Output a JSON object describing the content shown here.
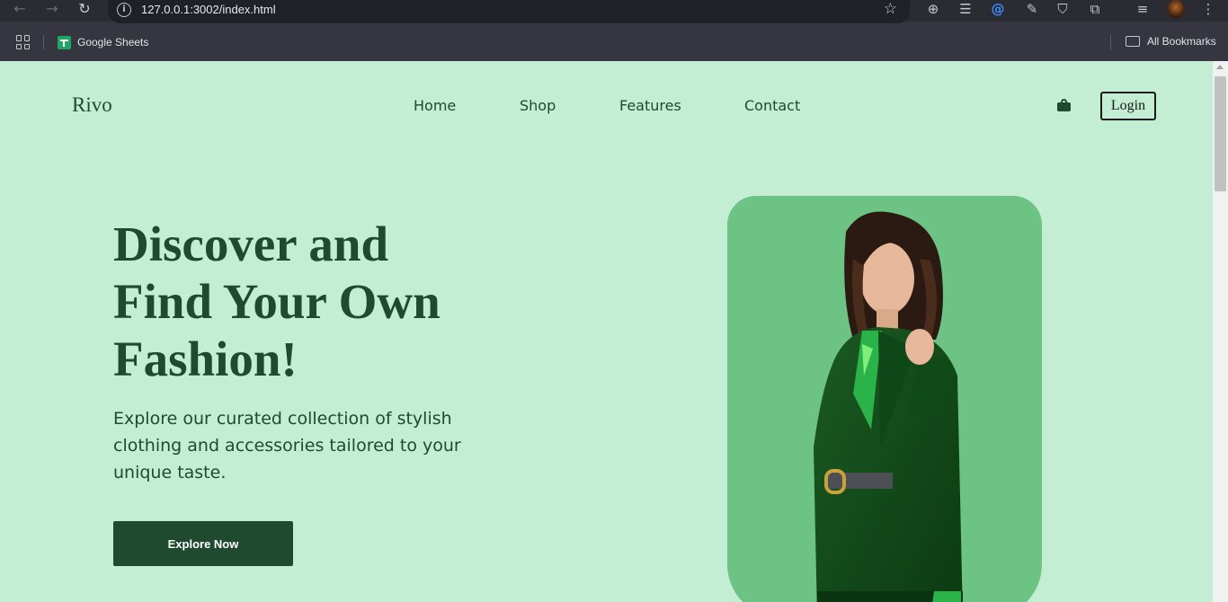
{
  "browser": {
    "url": "127.0.0.1:3002/index.html",
    "bookmarks": [
      {
        "label": "Google Sheets"
      }
    ],
    "all_bookmarks_label": "All Bookmarks"
  },
  "site": {
    "logo": "Rivo",
    "nav": [
      "Home",
      "Shop",
      "Features",
      "Contact"
    ],
    "login_label": "Login",
    "hero": {
      "title_lines": [
        "Discover and",
        "Find Your Own",
        "Fashion!"
      ],
      "description": "Explore our curated collection of stylish clothing and accessories tailored to your unique taste.",
      "cta_label": "Explore Now"
    }
  },
  "colors": {
    "page_bg": "#c3eed3",
    "primary": "#1f4a30",
    "photo_card": "#6cc383"
  }
}
